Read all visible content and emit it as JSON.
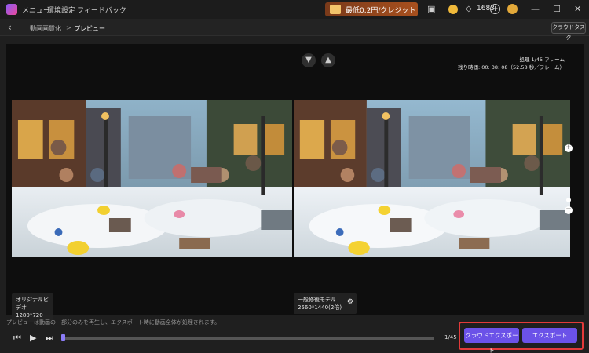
{
  "titlebar": {
    "menu": "メニュー",
    "settings": "環境設定",
    "feedback": "フィードバック",
    "promo": "最低0.2円/クレジット",
    "credits": "1683"
  },
  "breadcrumb": {
    "parent": "動画画質化",
    "separator": ">",
    "current": "プレビュー"
  },
  "cloud_task_label": "クラウドタスク",
  "processing": {
    "frames": "処理 1/45 フレーム",
    "remaining": "残り時間: 00: 38: 08（52.58 秒／フレーム）"
  },
  "left_label": {
    "title": "オリジナルビデオ",
    "resolution": "1280*720"
  },
  "right_label": {
    "title": "一般修復モデル",
    "resolution": "2560*1440(2倍)"
  },
  "notice": "プレビューは動画の一部分のみを再生し、エクスポート時に動画全体が処理されます。",
  "frame_counter": "1/45",
  "buttons": {
    "cloud_export": "クラウドエクスポート",
    "export": "エクスポート"
  },
  "icons": {
    "back": "chevron-left-icon",
    "thumb_down": "thumbs-down-icon",
    "thumb_up": "thumbs-up-icon",
    "zoom_in": "plus-icon",
    "zoom_out": "minus-icon",
    "settings": "sliders-icon"
  },
  "colors": {
    "accent": "#6b52e8",
    "highlight_frame": "#e23a3a"
  },
  "progress": {
    "playhead_fraction": 0.0
  }
}
